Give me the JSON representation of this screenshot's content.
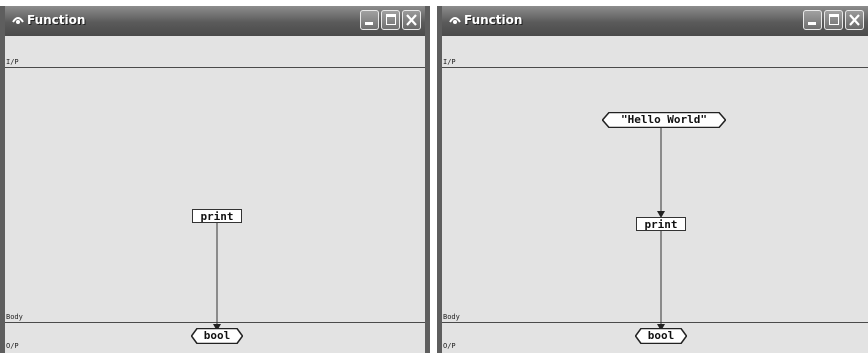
{
  "windows": [
    {
      "title": "Function",
      "labels": {
        "input": "I/P",
        "body": "Body",
        "output": "O/P"
      },
      "nodes": {
        "print": "print",
        "return": "bool"
      }
    },
    {
      "title": "Function",
      "labels": {
        "input": "I/P",
        "body": "Body",
        "output": "O/P"
      },
      "nodes": {
        "literal": "\"Hello World\"",
        "print": "print",
        "return": "bool"
      }
    }
  ]
}
